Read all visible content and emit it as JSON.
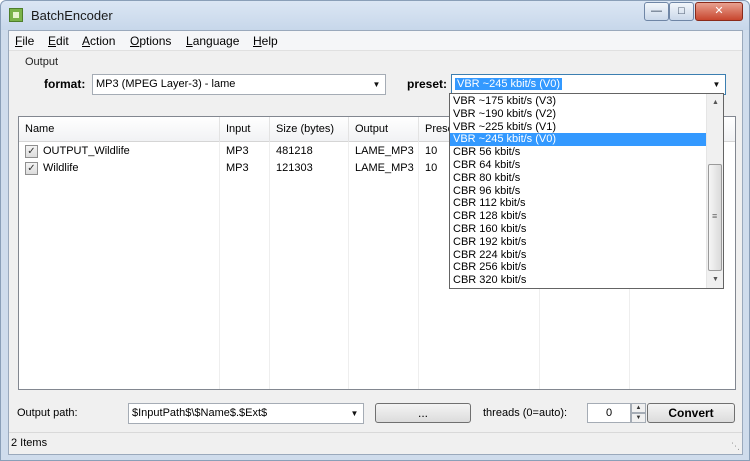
{
  "window": {
    "title": "BatchEncoder"
  },
  "menu": [
    {
      "accel": "F",
      "rest": "ile"
    },
    {
      "accel": "E",
      "rest": "dit"
    },
    {
      "accel": "A",
      "rest": "ction"
    },
    {
      "accel": "O",
      "rest": "ptions"
    },
    {
      "accel": "L",
      "rest": "anguage"
    },
    {
      "accel": "H",
      "rest": "elp"
    }
  ],
  "output": {
    "group_label": "Output",
    "format_label": "format:",
    "format_value": "MP3 (MPEG Layer-3) - lame",
    "preset_label": "preset:",
    "preset_value": "VBR ~245 kbit/s (V0)"
  },
  "list": {
    "columns": [
      "Name",
      "Input",
      "Size (bytes)",
      "Output",
      "Prese"
    ],
    "rows": [
      {
        "checked": true,
        "name": "OUTPUT_Wildlife",
        "input": "MP3",
        "size": "481218",
        "output": "LAME_MP3",
        "preset": "10"
      },
      {
        "checked": true,
        "name": "Wildlife",
        "input": "MP3",
        "size": "121303",
        "output": "LAME_MP3",
        "preset": "10"
      }
    ]
  },
  "preset_options": [
    "VBR ~175 kbit/s (V3)",
    "VBR ~190 kbit/s (V2)",
    "VBR ~225 kbit/s (V1)",
    "VBR ~245 kbit/s (V0)",
    "CBR 56 kbit/s",
    "CBR 64 kbit/s",
    "CBR 80 kbit/s",
    "CBR 96 kbit/s",
    "CBR 112 kbit/s",
    "CBR 128 kbit/s",
    "CBR 160 kbit/s",
    "CBR 192 kbit/s",
    "CBR 224 kbit/s",
    "CBR 256 kbit/s",
    "CBR 320 kbit/s"
  ],
  "preset_selected": "VBR ~245 kbit/s (V0)",
  "bottom": {
    "output_path_label": "Output path:",
    "output_path_value": "$InputPath$\\$Name$.$Ext$",
    "browse_label": "...",
    "threads_label": "threads (0=auto):",
    "threads_value": "0",
    "convert_label": "Convert"
  },
  "status": {
    "text": "2 Items"
  },
  "icons": {
    "app": "batchencoder-app-icon",
    "minimize": "minimize-icon",
    "maximize": "maximize-icon",
    "close": "close-icon",
    "dropdown": "chevron-down-icon",
    "checkbox": "checkmark-icon"
  }
}
